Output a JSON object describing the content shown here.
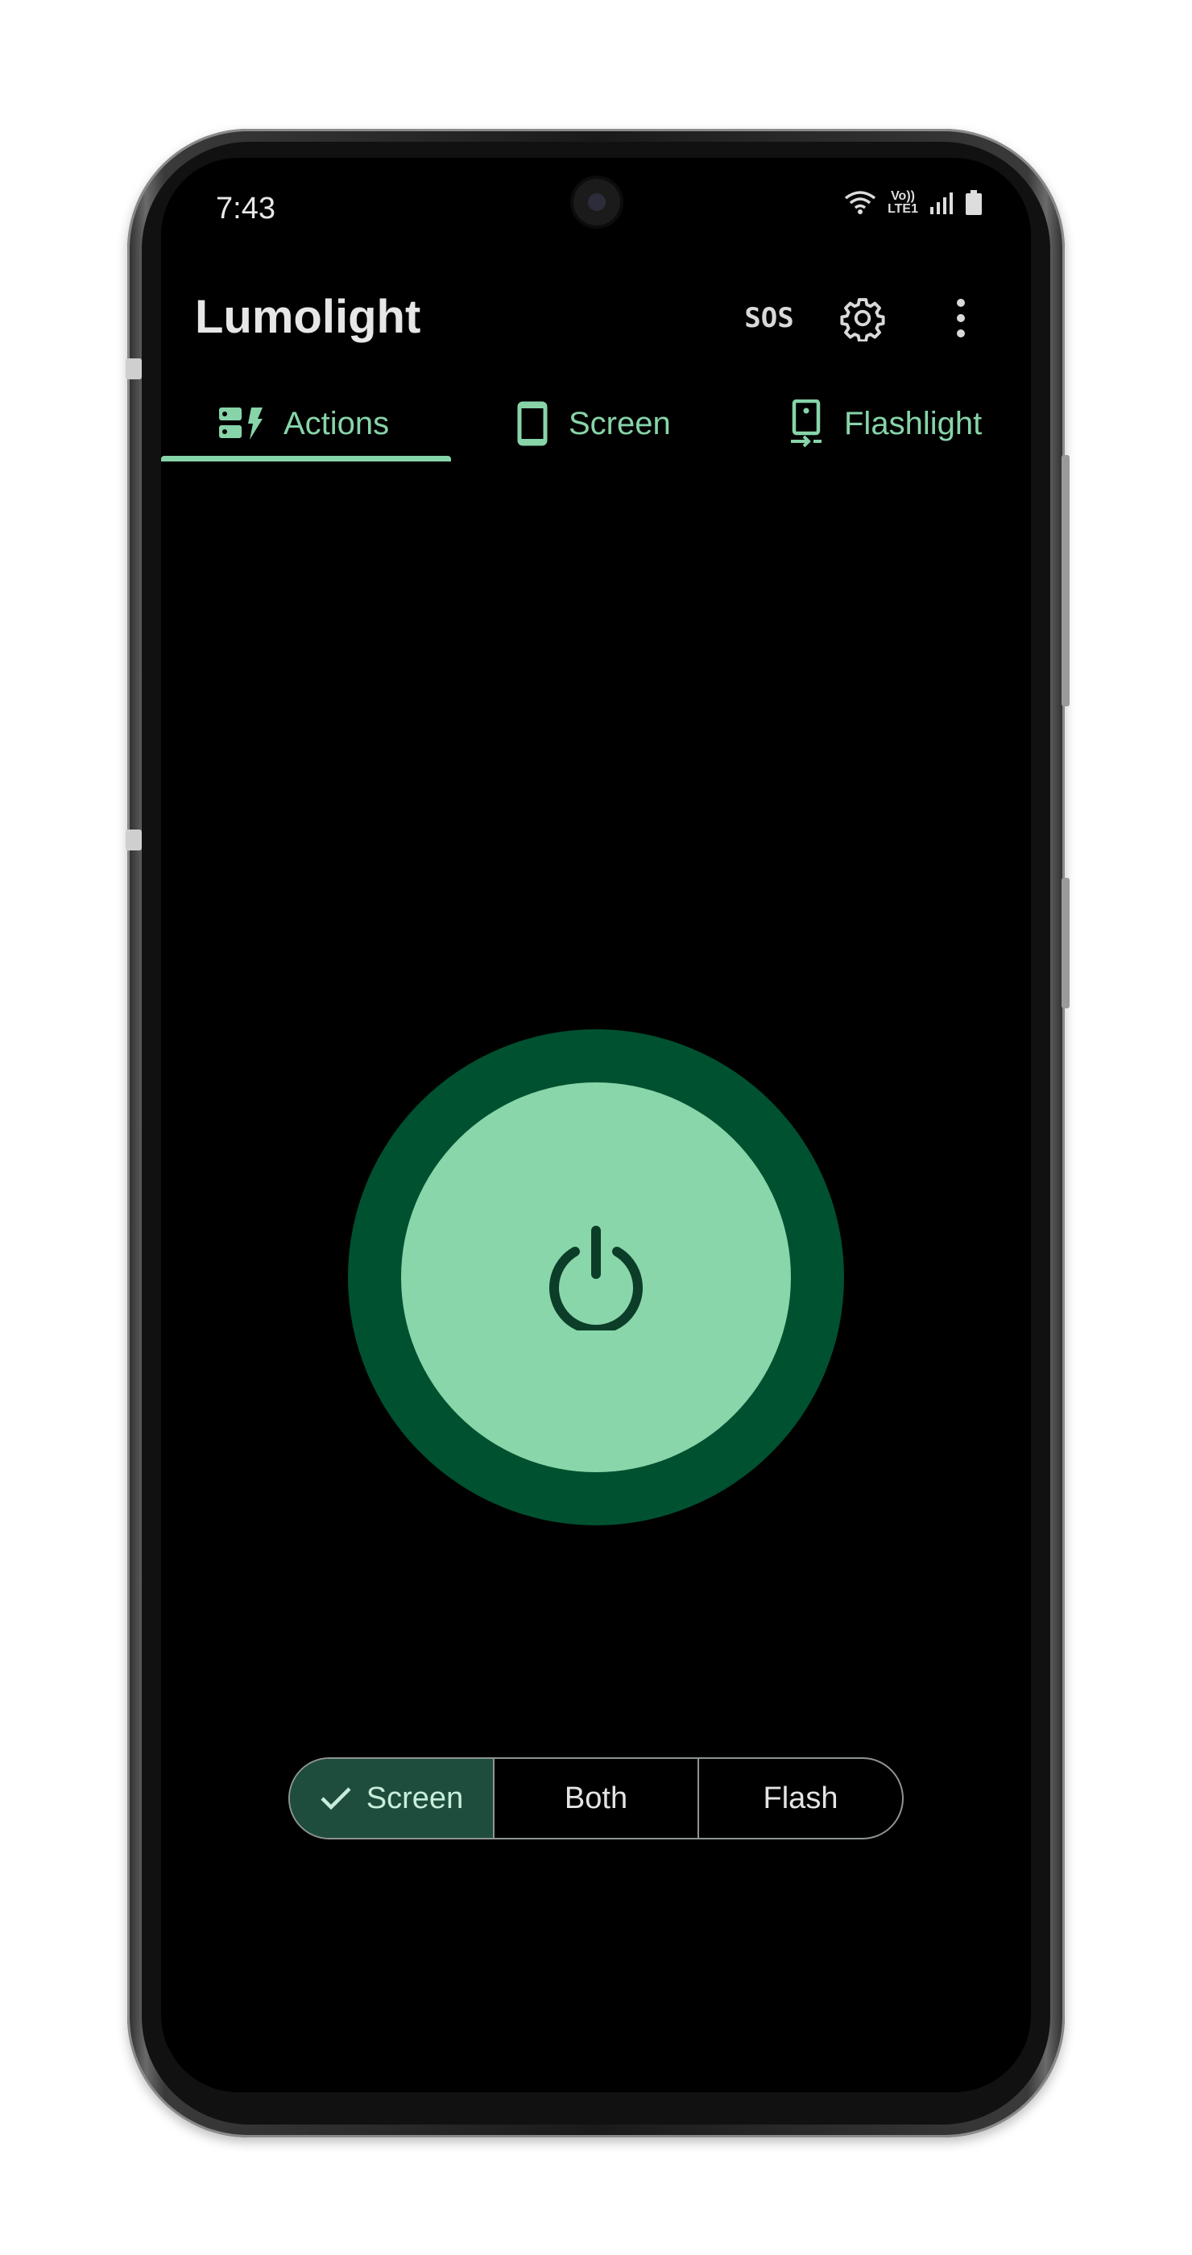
{
  "status_bar": {
    "time": "7:43",
    "network_label_top": "Vo))",
    "network_label_bottom": "LTE1",
    "icons": [
      "wifi-icon",
      "volte-lte-icon",
      "signal-icon",
      "battery-icon"
    ]
  },
  "app_bar": {
    "title": "Lumolight",
    "actions": [
      "sos-icon",
      "settings-gear-icon",
      "more-vert-icon"
    ]
  },
  "tabs": [
    {
      "label": "Actions",
      "icon": "actions-icon",
      "selected": true
    },
    {
      "label": "Screen",
      "icon": "phone-screen-icon",
      "selected": false
    },
    {
      "label": "Flashlight",
      "icon": "flashlight-icon",
      "selected": false
    }
  ],
  "power_button": {
    "icon": "power-icon"
  },
  "mode_selector": {
    "options": [
      {
        "label": "Screen",
        "selected": true
      },
      {
        "label": "Both",
        "selected": false
      },
      {
        "label": "Flash",
        "selected": false
      }
    ]
  },
  "colors": {
    "background": "#000000",
    "accent": "#87d4a9",
    "power_ring": "#005130",
    "power_fill": "#89d6aa",
    "segment_selected": "#1e4d3d"
  }
}
